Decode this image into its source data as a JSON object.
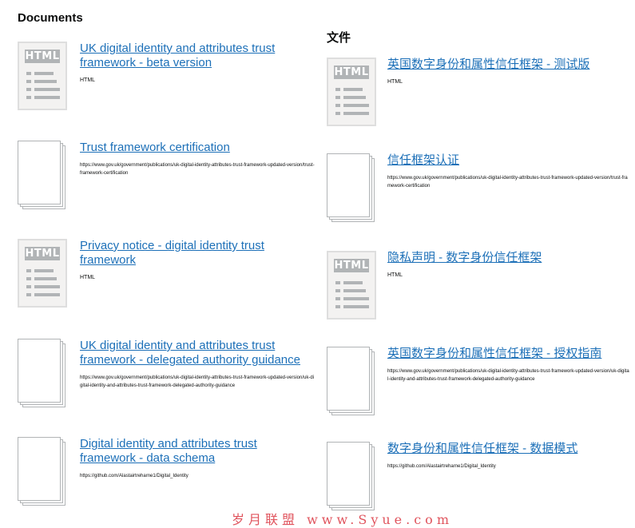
{
  "left": {
    "heading": "Documents",
    "documents": [
      {
        "title": "UK digital identity and attributes trust framework - beta version",
        "meta": "HTML"
      },
      {
        "title": "Trust framework certification",
        "meta": "https://www.gov.uk/government/publications/uk-digital-identity-attributes-trust-framework-updated-version/trust-framework-certification"
      },
      {
        "title": "Privacy notice - digital identity trust framework",
        "meta": "HTML"
      },
      {
        "title": "UK digital identity and attributes trust framework - delegated authority guidance",
        "meta": "https://www.gov.uk/government/publications/uk-digital-identity-attributes-trust-framework-updated-version/uk-digital-identity-and-attributes-trust-framework-delegated-authority-guidance"
      },
      {
        "title": "Digital identity and attributes trust framework - data schema",
        "meta": "https://github.com/Alastairtreharne1/Digital_Identity"
      }
    ]
  },
  "right": {
    "heading": "文件",
    "documents": [
      {
        "title": "英国数字身份和属性信任框架 - 测试版",
        "meta": "HTML"
      },
      {
        "title": "信任框架认证",
        "meta": "https://www.gov.uk/government/publications/uk-digital-identity-attributes-trust-framework-updated-version/trust-framework-certification"
      },
      {
        "title": "隐私声明 - 数字身份信任框架",
        "meta": "HTML"
      },
      {
        "title": "英国数字身份和属性信任框架 - 授权指南",
        "meta": "https://www.gov.uk/government/publications/uk-digital-identity-attributes-trust-framework-updated-version/uk-digital-identity-and-attributes-trust-framework-delegated-authority-guidance"
      },
      {
        "title": "数字身份和属性信任框架 - 数据模式",
        "meta": "https://github.com/Alastairtreharne1/Digital_Identity"
      }
    ]
  },
  "thumbnail_badge": "HTML",
  "watermark": "岁月联盟 www.Syue.com"
}
